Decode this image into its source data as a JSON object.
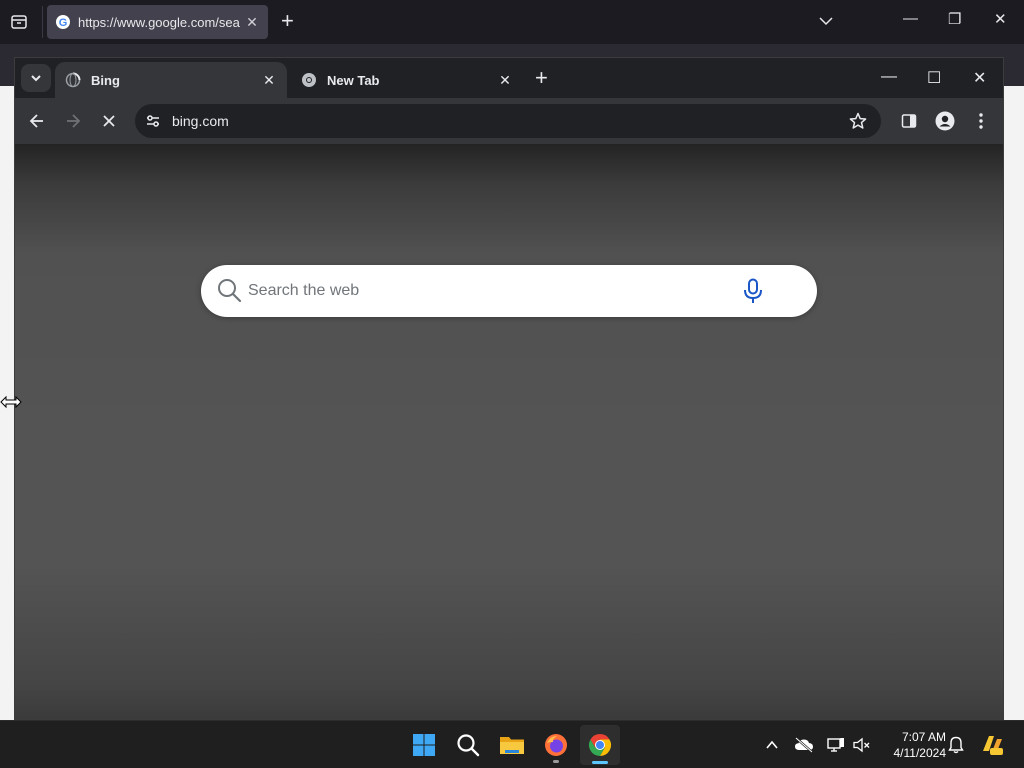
{
  "background_browser": {
    "tab_title": "https://www.google.com/search",
    "new_tab_label": "+",
    "list_all_tabs": "list-all-tabs-icon",
    "tab_close": "✕",
    "minimize": "—",
    "restore": "❐",
    "close": "✕"
  },
  "chrome": {
    "tabs": [
      {
        "title": "Bing",
        "active": true,
        "close": "✕"
      },
      {
        "title": "New Tab",
        "active": false,
        "close": "✕"
      }
    ],
    "new_tab": "+",
    "window_controls": {
      "minimize": "—",
      "maximize": "☐",
      "close": "✕"
    },
    "address": "bing.com"
  },
  "page": {
    "search_placeholder": "Search the web"
  },
  "taskbar": {
    "apps": [
      "start-icon",
      "search-icon",
      "file-explorer-icon",
      "firefox-icon",
      "chrome-icon"
    ],
    "time": "7:07 AM",
    "date": "4/11/2024",
    "colors": {
      "accent": "#5cc6ff",
      "bar": "#1f1f1f"
    }
  }
}
